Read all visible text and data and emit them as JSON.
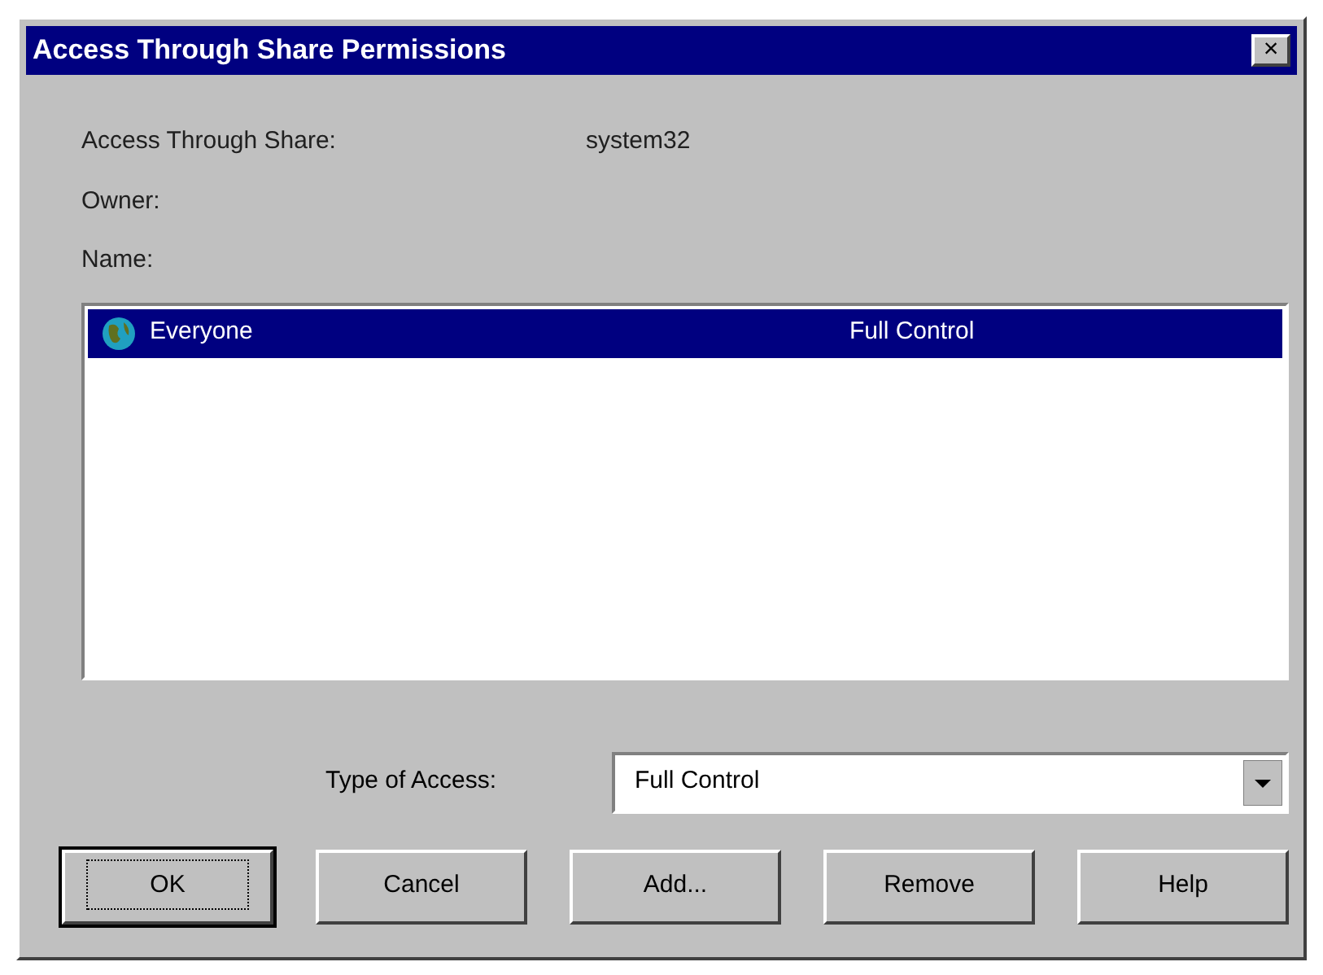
{
  "window": {
    "title": "Access Through Share Permissions",
    "close": "×"
  },
  "fields": [
    {
      "label": "Access Through Share:",
      "value": "system32"
    },
    {
      "label": "Owner:"
    },
    {
      "label": "Name:"
    }
  ],
  "list": {
    "rows": [
      {
        "name": "Everyone",
        "access": "Full Control",
        "selected": true
      }
    ]
  },
  "type_of_access": {
    "label": "Type of Access:",
    "value": "Full Control"
  },
  "buttons": [
    {
      "label": "OK",
      "default": true
    },
    {
      "label": "Cancel",
      "default": false
    },
    {
      "label": "Add...",
      "default": false
    },
    {
      "label": "Remove",
      "default": false
    },
    {
      "label": "Help",
      "default": false
    }
  ]
}
